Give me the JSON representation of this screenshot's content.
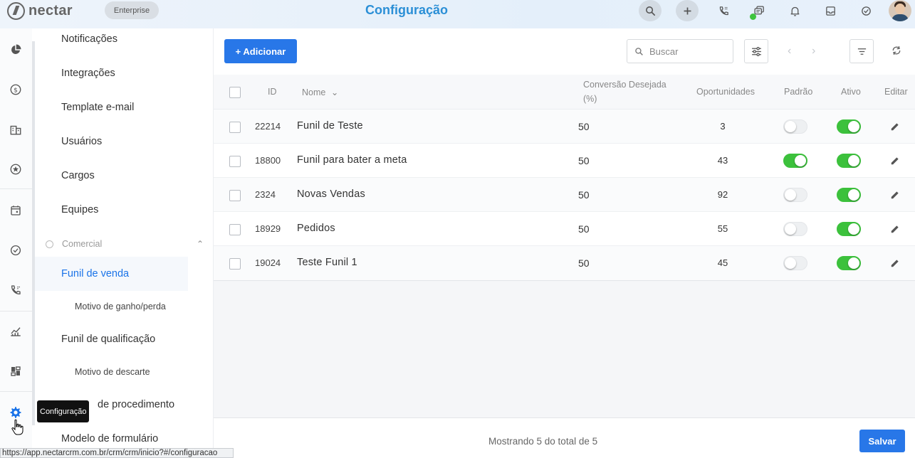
{
  "brand": {
    "logo_text": "nectar",
    "plan": "Enterprise"
  },
  "header": {
    "title": "Configuração"
  },
  "topbar_icons": [
    "search-icon",
    "plus-icon",
    "phone-icon",
    "chat-icon",
    "bell-icon",
    "inbox-icon",
    "check-circle-icon",
    "avatar"
  ],
  "rail_icons": [
    "pie-chart-icon",
    "dollar-icon",
    "building-icon",
    "star-icon",
    "calendar-icon",
    "check-circle-icon",
    "phone-icon",
    "chart-line-icon",
    "dashboard-icon",
    "gear-icon"
  ],
  "menu": {
    "items": [
      {
        "label": "Notificações"
      },
      {
        "label": "Integrações"
      },
      {
        "label": "Template e-mail"
      },
      {
        "label": "Usuários"
      },
      {
        "label": "Cargos"
      },
      {
        "label": "Equipes"
      }
    ],
    "group_label": "Comercial",
    "group_items": [
      {
        "label": "Funil de venda"
      },
      {
        "label": "Motivo de ganho/perda"
      },
      {
        "label": "Funil de qualificação"
      },
      {
        "label": "Motivo de descarte"
      },
      {
        "label": "de procedimento"
      },
      {
        "label": "Modelo de formulário"
      }
    ]
  },
  "tooltip": "Configuração",
  "statusbar_url": "https://app.nectarcrm.com.br/crm/crm/inicio?#/configuracao",
  "toolbar": {
    "add_label": "+ Adicionar",
    "search_placeholder": "Buscar"
  },
  "table": {
    "headers": {
      "id": "ID",
      "name": "Nome",
      "conversion_line1": "Conversão Desejada",
      "conversion_line2": "(%)",
      "opportunities": "Oportunidades",
      "default": "Padrão",
      "active": "Ativo",
      "edit": "Editar"
    },
    "rows": [
      {
        "id": "22214",
        "name": "Funil de Teste",
        "conversion": "50",
        "opportunities": "3",
        "default": false,
        "active": true
      },
      {
        "id": "18800",
        "name": "Funil para bater a meta",
        "conversion": "50",
        "opportunities": "43",
        "default": true,
        "active": true
      },
      {
        "id": "2324",
        "name": "Novas Vendas",
        "conversion": "50",
        "opportunities": "92",
        "default": false,
        "active": true
      },
      {
        "id": "18929",
        "name": "Pedidos",
        "conversion": "50",
        "opportunities": "55",
        "default": false,
        "active": true
      },
      {
        "id": "19024",
        "name": "Teste Funil 1",
        "conversion": "50",
        "opportunities": "45",
        "default": false,
        "active": true
      }
    ]
  },
  "footer": {
    "summary": "Mostrando 5 do total de 5",
    "save_label": "Salvar"
  },
  "colors": {
    "accent": "#2877e8",
    "title": "#2b8fd6",
    "toggle_on": "#3cc13c"
  }
}
